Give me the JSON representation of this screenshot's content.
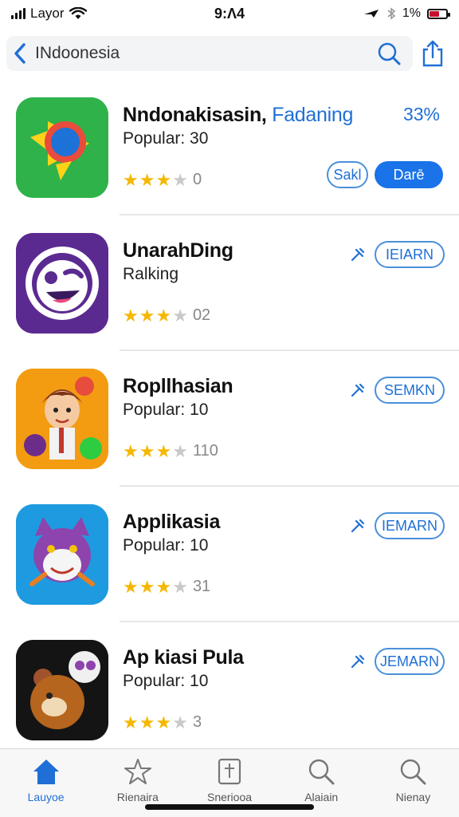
{
  "status_bar": {
    "carrier": "Layor",
    "time": "9:Λ4",
    "battery": "1%"
  },
  "nav": {
    "title": "INdoonesia"
  },
  "apps": [
    {
      "name": "Nndonakisasin,",
      "name_accent": "Fadaning",
      "subtitle": "Popular: 30",
      "rating_count": "0",
      "rating_stars": 3,
      "percent": "33%",
      "secondary_button": "Sakl",
      "primary_button": "Darē"
    },
    {
      "name": "UnarahDing",
      "subtitle": "Ralking",
      "rating_count": "02",
      "rating_stars": 3,
      "button": "IEIARN"
    },
    {
      "name": "Ropllhasian",
      "subtitle": "Popular: 10",
      "rating_count": "110",
      "rating_stars": 3,
      "button": "SEMKN"
    },
    {
      "name": "Applikasia",
      "subtitle": "Popular: 10",
      "rating_count": "31",
      "rating_stars": 3,
      "button": "IEMARN"
    },
    {
      "name": "Ap kiasi Pula",
      "subtitle": "Popular: 10",
      "rating_count": "3",
      "rating_stars": 3,
      "button": "JEMARN"
    }
  ],
  "tabs": [
    {
      "label": "Lauyoe",
      "icon": "house-icon"
    },
    {
      "label": "Rienaira",
      "icon": "star-icon"
    },
    {
      "label": "Sneriooa",
      "icon": "book-icon"
    },
    {
      "label": "Alaiain",
      "icon": "search-icon"
    },
    {
      "label": "Nienay",
      "icon": "search-icon"
    }
  ],
  "colors": {
    "accent": "#1f6fd6",
    "star": "#f5b800",
    "battery_low": "#c8102e"
  }
}
